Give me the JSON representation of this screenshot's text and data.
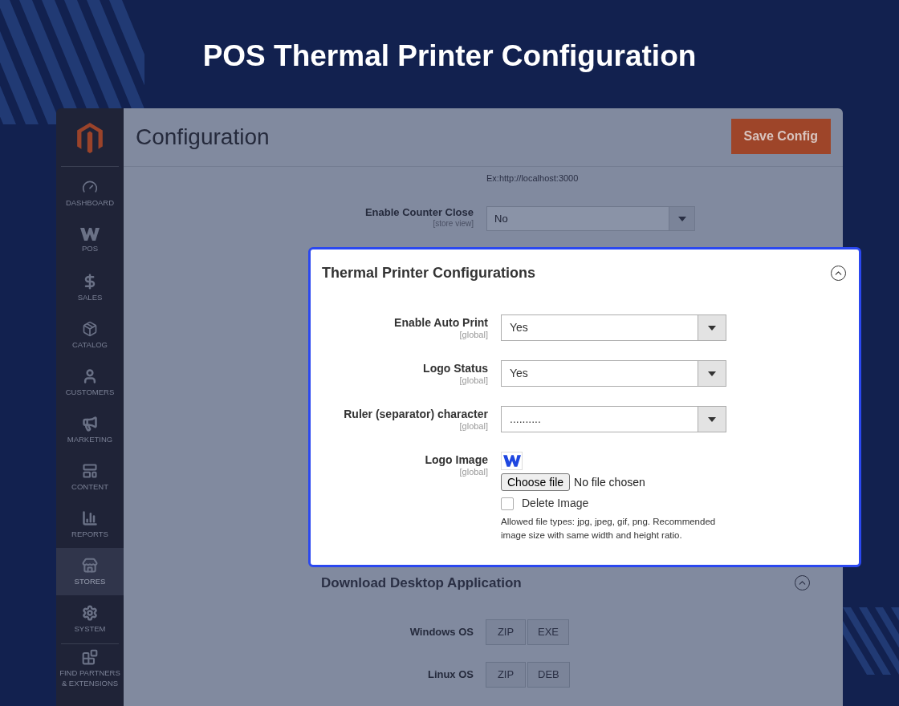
{
  "title": "POS Thermal Printer Configuration",
  "sidebar": {
    "items": [
      {
        "label": "DASHBOARD",
        "selected": false
      },
      {
        "label": "POS",
        "selected": false
      },
      {
        "label": "SALES",
        "selected": false
      },
      {
        "label": "CATALOG",
        "selected": false
      },
      {
        "label": "CUSTOMERS",
        "selected": false
      },
      {
        "label": "MARKETING",
        "selected": false
      },
      {
        "label": "CONTENT",
        "selected": false
      },
      {
        "label": "REPORTS",
        "selected": false
      },
      {
        "label": "STORES",
        "selected": true
      },
      {
        "label": "SYSTEM",
        "selected": false
      },
      {
        "label": "FIND PARTNERS & EXTENSIONS",
        "selected": false
      }
    ]
  },
  "header": {
    "title": "Configuration",
    "button": "Save Config"
  },
  "hint": "Ex:http://localhost:3000",
  "counter_close": {
    "label": "Enable Counter Close",
    "scope": "[store view]",
    "value": "No"
  },
  "popup": {
    "title": "Thermal Printer Configurations",
    "expanded": true,
    "fields": [
      {
        "kind": "select",
        "label": "Enable Auto Print",
        "scope": "[global]",
        "value": "Yes"
      },
      {
        "kind": "select",
        "label": "Logo Status",
        "scope": "[global]",
        "value": "Yes"
      },
      {
        "kind": "select",
        "label": "Ruler (separator) character",
        "scope": "[global]",
        "value": ".........."
      },
      {
        "kind": "image",
        "label": "Logo Image",
        "scope": "[global]",
        "button": "Choose file",
        "file_status": "No file chosen",
        "delete_label": "Delete Image",
        "delete_checked": false,
        "note": "Allowed file types: jpg, jpeg, gif, png. Recommended image size with same width and height ratio."
      }
    ]
  },
  "download": {
    "title": "Download Desktop Application",
    "expanded": true,
    "rows": [
      {
        "label": "Windows OS",
        "buttons": [
          "ZIP",
          "EXE"
        ]
      },
      {
        "label": "Linux OS",
        "buttons": [
          "ZIP",
          "DEB"
        ]
      }
    ]
  }
}
